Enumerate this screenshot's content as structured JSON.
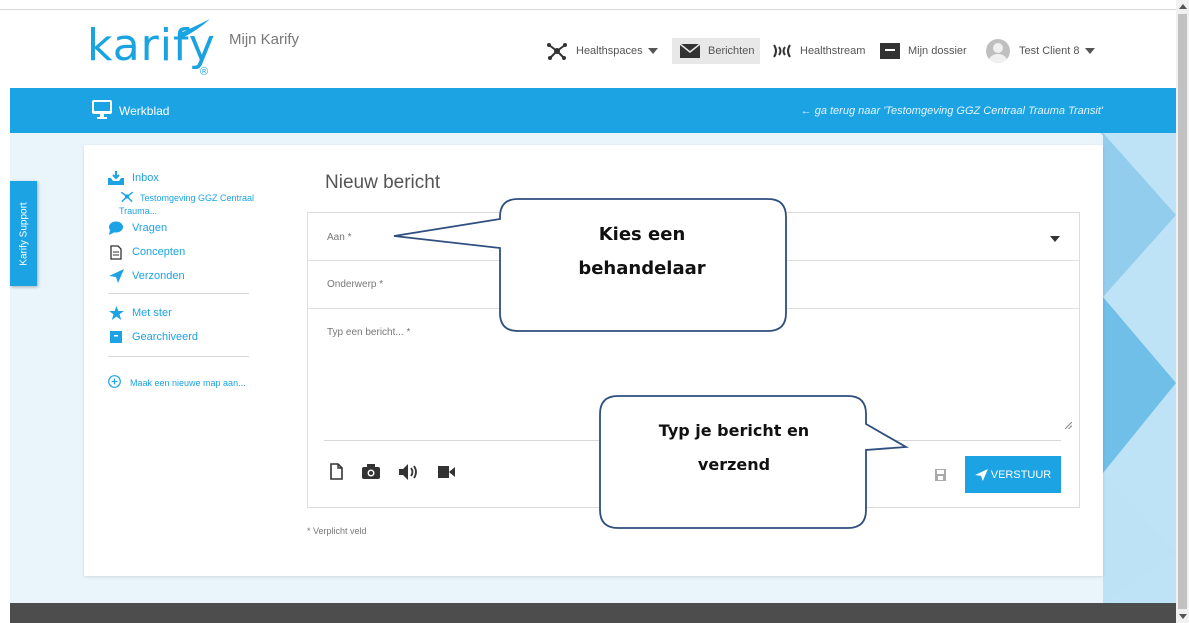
{
  "header": {
    "logo": "karify",
    "logo_reg": "®",
    "subtitle": "Mijn Karify",
    "nav": {
      "healthspaces": "Healthspaces",
      "berichten": "Berichten",
      "healthstream": "Healthstream",
      "dossier": "Mijn dossier",
      "user": "Test Client 8"
    }
  },
  "bluebar": {
    "werkblad": "Werkblad",
    "back_link": "← ga terug naar 'Testomgeving GGZ Centraal Trauma Transit'"
  },
  "support": {
    "label": "Karify Support"
  },
  "sidebar": {
    "inbox": "Inbox",
    "inbox_sub_1": "Testomgeving GGZ Centraal",
    "inbox_sub_2": "Trauma...",
    "vragen": "Vragen",
    "concepten": "Concepten",
    "verzonden": "Verzonden",
    "met_ster": "Met ster",
    "gearchiveerd": "Gearchiveerd",
    "new_folder": "Maak een nieuwe map aan..."
  },
  "compose": {
    "title": "Nieuw bericht",
    "to_label": "Aan *",
    "subject_label": "Onderwerp *",
    "message_placeholder": "Typ een bericht... *",
    "send_label": "VERSTUUR",
    "required_note": "* Verplicht veld"
  },
  "callouts": {
    "choose_line1": "Kies een",
    "choose_line2": "behandelaar",
    "type_line1": "Typ je bericht en",
    "type_line2": "verzend"
  },
  "colors": {
    "brand_blue": "#1ca3e3",
    "footer": "#4d4d4d",
    "background": "#e9f5fb"
  },
  "icons": {
    "nav": [
      "healthspaces-icon",
      "envelope-icon",
      "healthstream-icon",
      "dossier-icon",
      "avatar"
    ],
    "sidebar": [
      "inbox-icon",
      "healthspace-icon",
      "speech-bubble-icon",
      "document-icon",
      "paper-plane-icon",
      "star-icon",
      "archive-icon",
      "plus-circle-icon"
    ],
    "tools": [
      "file-icon",
      "camera-icon",
      "audio-icon",
      "video-icon",
      "save-icon"
    ]
  }
}
